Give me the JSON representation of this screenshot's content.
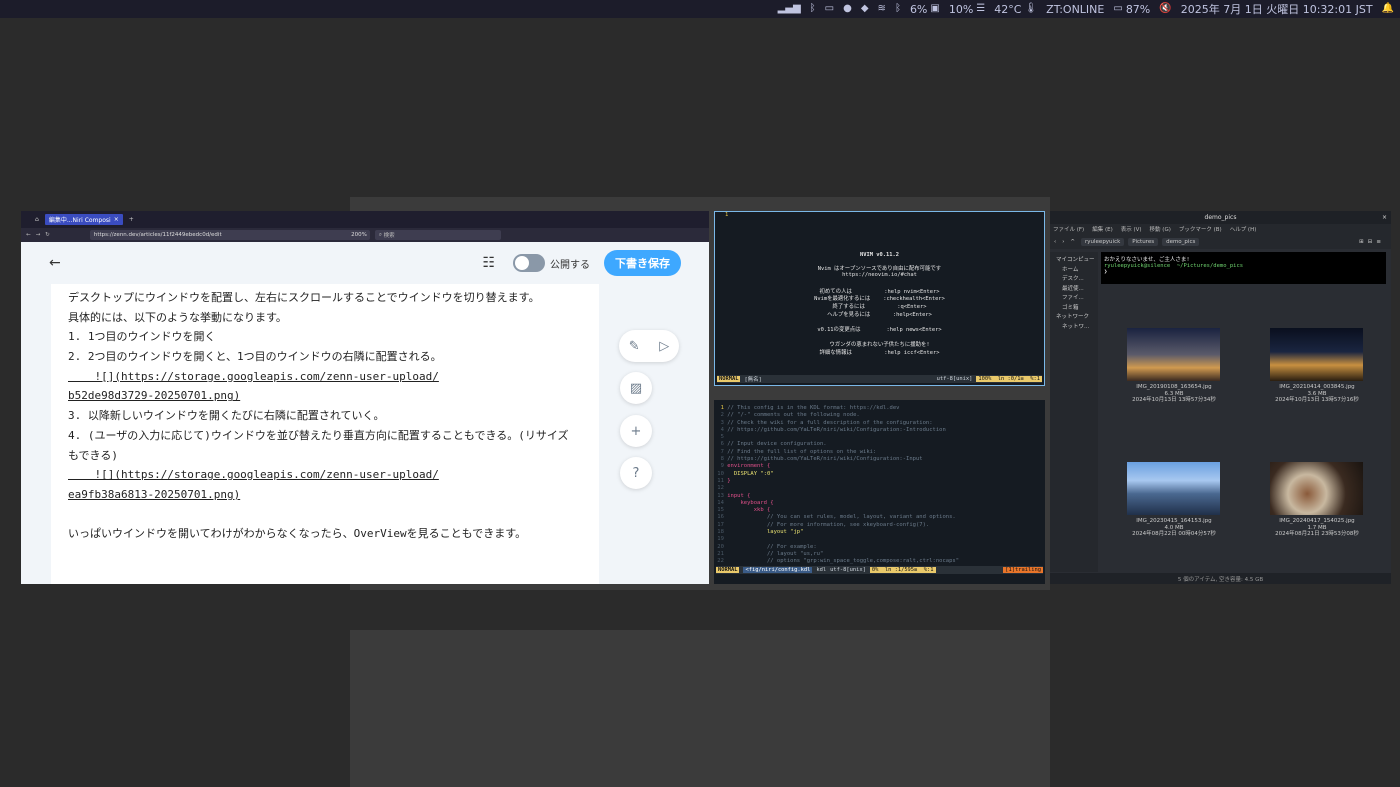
{
  "topbar": {
    "cpu": "6%",
    "mem": "10%",
    "temp": "42°C",
    "network": "ZT:ONLINE",
    "battery": "87%",
    "datetime": "2025年 7月 1日 火曜日 10:32:01 JST"
  },
  "browser": {
    "tab_title": "編集中...Niri Composi",
    "url": "https://zenn.dev/articles/11f2449ebedc0d/edit",
    "zoom": "200%",
    "search_placeholder": "検索",
    "public_label": "公開する",
    "save_label": "下書き保存",
    "editor_lines": [
      "デスクトップにウインドウを配置し、左右にスクロールすることでウインドウを切り替えます。",
      "具体的には、以下のような挙動になります。",
      "1. 1つ目のウインドウを開く",
      "2. 2つ目のウインドウを開くと、1つ目のウインドウの右隣に配置される。",
      "    ![](https://storage.googleapis.com/zenn-user-upload/",
      "b52de98d3729-20250701.png)",
      "3. 以降新しいウインドウを開くたびに右隣に配置されていく。",
      "4. (ユーザの入力に応じて)ウインドウを並び替えたり垂直方向に配置することもできる。(リサイズ",
      "もできる)",
      "    ![](https://storage.googleapis.com/zenn-user-upload/",
      "ea9fb38a6813-20250701.png)",
      "",
      "いっぱいウインドウを開いてわけがわからなくなったら、OverViewを見ることもできます。"
    ]
  },
  "nvim_splash": {
    "title": "NVIM v0.11.2",
    "lines": [
      "Nvim はオープンソースであり自由に配布可能です",
      "https://neovim.io/#chat",
      "",
      "初めての人は          :help nvim<Enter>",
      "Nvimを最適化するには    :checkhealth<Enter>",
      "終了するには          :q<Enter>",
      "ヘルプを見るには       :help<Enter>",
      "",
      "v0.11の変更点は        :help news<Enter>",
      "",
      "ウガンダの恵まれない子供たちに援助を!",
      "詳細な情報は          :help iccf<Enter>"
    ],
    "status_mode": "NORMAL",
    "status_file": "[無名]",
    "status_enc": "utf-8[unix]",
    "status_pos": "100%  ln :0/1≡  %:1"
  },
  "nvim_config": {
    "lines": [
      "// This config is in the KDL format: https://kdl.dev",
      "// \"/-\" comments out the following node.",
      "// Check the wiki for a full description of the configuration:",
      "// https://github.com/YaLTeR/niri/wiki/Configuration:-Introduction",
      "",
      "// Input device configuration.",
      "// Find the full list of options on the wiki:",
      "// https://github.com/YaLTeR/niri/wiki/Configuration:-Input",
      "environment {",
      "  DISPLAY \":0\"",
      "}",
      "",
      "input {",
      "    keyboard {",
      "        xkb {",
      "            // You can set rules, model, layout, variant and options.",
      "            // For more information, see xkeyboard-config(7).",
      "            layout \"jp\"",
      "",
      "            // For example:",
      "            // layout \"us,ru\"",
      "            // options \"grp:win_space_toggle,compose:ralt,ctrl:nocaps\""
    ],
    "status_mode": "NORMAL",
    "status_file": "<fig/niri/config.kdl",
    "status_ft": "kdl",
    "status_enc": "utf-8[unix]",
    "status_pos": "0%  ln :1/595≡  %:1",
    "status_extra": "[1]trailing"
  },
  "file_manager": {
    "title": "demo_pics",
    "menu": [
      "ファイル (F)",
      "編集 (E)",
      "表示 (V)",
      "移動 (G)",
      "ブックマーク (B)",
      "ヘルプ (H)"
    ],
    "breadcrumbs": [
      "ryuleepyuick",
      "Pictures",
      "demo_pics"
    ],
    "sidebar": [
      "マイコンピュー",
      "ホーム",
      "デスク...",
      "最近使...",
      "ファイ...",
      "ゴミ箱",
      "ネットワーク",
      "ネットワ..."
    ],
    "terminal_lines": [
      "おかえりなさいませ、ご主人さま!",
      "ryuleepyuick@silence  ~/Pictures/demo_pics",
      "❯ "
    ],
    "files": [
      {
        "name": "IMG_20190108_163654.jpg",
        "size": "6.3 MB",
        "date": "2024年10月13日 13時57分34秒"
      },
      {
        "name": "IMG_20210414_003845.jpg",
        "size": "3.6 MB",
        "date": "2024年10月13日 13時57分16秒"
      },
      {
        "name": "IMG_20230415_164153.jpg",
        "size": "4.0 MB",
        "date": "2024年08月22日 00時04分57秒"
      },
      {
        "name": "IMG_20240417_154025.jpg",
        "size": "1.7 MB",
        "date": "2024年08月21日 23時53分08秒"
      }
    ],
    "status": "5 個のアイテム, 空き容量: 4.5 GB"
  }
}
